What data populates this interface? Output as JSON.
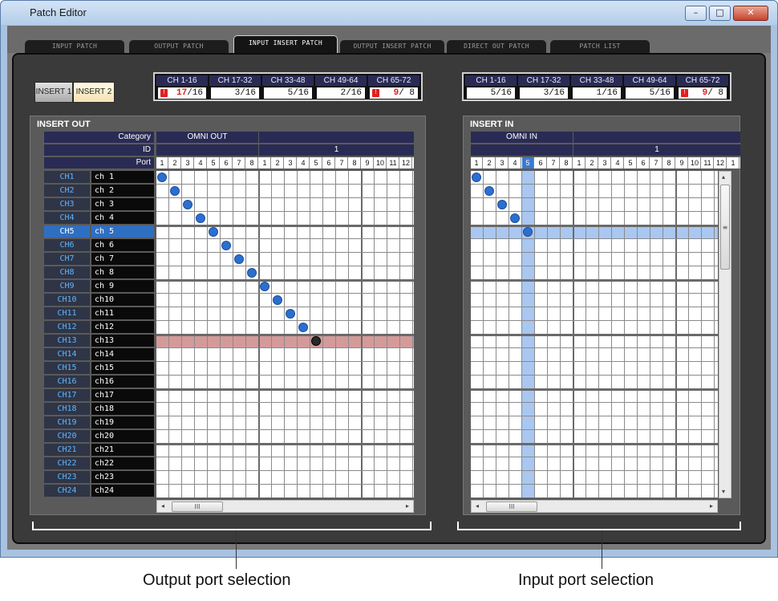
{
  "window": {
    "title": "Patch Editor",
    "minimize_glyph": "–",
    "maximize_glyph": "□",
    "close_glyph": "✕"
  },
  "tabs": [
    {
      "label": "INPUT PATCH",
      "active": false
    },
    {
      "label": "OUTPUT PATCH",
      "active": false
    },
    {
      "label": "INPUT INSERT PATCH",
      "active": true
    },
    {
      "label": "OUTPUT INSERT PATCH",
      "active": false
    },
    {
      "label": "DIRECT OUT PATCH",
      "active": false
    },
    {
      "label": "PATCH LIST",
      "active": false
    }
  ],
  "insert_buttons": {
    "insert1": "INSERT 1",
    "insert2": "INSERT 2",
    "active": "INSERT 2"
  },
  "out_counts": [
    {
      "range": "CH 1-16",
      "count": "17",
      "total": "/16",
      "warning": true
    },
    {
      "range": "CH 17-32",
      "count": "3",
      "total": "/16",
      "warning": false
    },
    {
      "range": "CH 33-48",
      "count": "5",
      "total": "/16",
      "warning": false
    },
    {
      "range": "CH 49-64",
      "count": "2",
      "total": "/16",
      "warning": false
    },
    {
      "range": "CH 65-72",
      "count": "9",
      "total": "/ 8",
      "warning": true
    }
  ],
  "in_counts": [
    {
      "range": "CH 1-16",
      "count": "5",
      "total": "/16",
      "warning": false
    },
    {
      "range": "CH 17-32",
      "count": "3",
      "total": "/16",
      "warning": false
    },
    {
      "range": "CH 33-48",
      "count": "1",
      "total": "/16",
      "warning": false
    },
    {
      "range": "CH 49-64",
      "count": "5",
      "total": "/16",
      "warning": false
    },
    {
      "range": "CH 65-72",
      "count": "9",
      "total": "/ 8",
      "warning": true
    }
  ],
  "insert_out": {
    "title": "INSERT OUT",
    "category_label": "Category",
    "id_label": "ID",
    "port_label": "Port",
    "category": "OMNI OUT",
    "id_value": "1",
    "ports": [
      "1",
      "2",
      "3",
      "4",
      "5",
      "6",
      "7",
      "8",
      "1",
      "2",
      "3",
      "4",
      "5",
      "6",
      "7",
      "8",
      "9",
      "10",
      "11",
      "12"
    ],
    "highlight_row": 12,
    "patches": [
      [
        0,
        0
      ],
      [
        1,
        1
      ],
      [
        2,
        2
      ],
      [
        3,
        3
      ],
      [
        4,
        4
      ],
      [
        5,
        5
      ],
      [
        6,
        6
      ],
      [
        7,
        7
      ],
      [
        8,
        8
      ],
      [
        9,
        9
      ],
      [
        10,
        10
      ],
      [
        11,
        11
      ],
      [
        12,
        12
      ]
    ],
    "conflict_patch": [
      12,
      12
    ]
  },
  "insert_in": {
    "title": "INSERT IN",
    "category": "OMNI IN",
    "id_value": "1",
    "ports": [
      "1",
      "2",
      "3",
      "4",
      "5",
      "6",
      "7",
      "8",
      "1",
      "2",
      "3",
      "4",
      "5",
      "6",
      "7",
      "8",
      "9",
      "10",
      "11",
      "12",
      "1"
    ],
    "highlight_col": 4,
    "highlight_row": 4,
    "patches": [
      [
        0,
        0
      ],
      [
        1,
        1
      ],
      [
        2,
        2
      ],
      [
        3,
        3
      ],
      [
        4,
        4
      ]
    ]
  },
  "channels": [
    {
      "ch": "CH1",
      "name": "ch 1"
    },
    {
      "ch": "CH2",
      "name": "ch 2"
    },
    {
      "ch": "CH3",
      "name": "ch 3"
    },
    {
      "ch": "CH4",
      "name": "ch 4"
    },
    {
      "ch": "CH5",
      "name": "ch 5"
    },
    {
      "ch": "CH6",
      "name": "ch 6"
    },
    {
      "ch": "CH7",
      "name": "ch 7"
    },
    {
      "ch": "CH8",
      "name": "ch 8"
    },
    {
      "ch": "CH9",
      "name": "ch 9"
    },
    {
      "ch": "CH10",
      "name": "ch10"
    },
    {
      "ch": "CH11",
      "name": "ch11"
    },
    {
      "ch": "CH12",
      "name": "ch12"
    },
    {
      "ch": "CH13",
      "name": "ch13"
    },
    {
      "ch": "CH14",
      "name": "ch14"
    },
    {
      "ch": "CH15",
      "name": "ch15"
    },
    {
      "ch": "CH16",
      "name": "ch16"
    },
    {
      "ch": "CH17",
      "name": "ch17"
    },
    {
      "ch": "CH18",
      "name": "ch18"
    },
    {
      "ch": "CH19",
      "name": "ch19"
    },
    {
      "ch": "CH20",
      "name": "ch20"
    },
    {
      "ch": "CH21",
      "name": "ch21"
    },
    {
      "ch": "CH22",
      "name": "ch22"
    },
    {
      "ch": "CH23",
      "name": "ch23"
    },
    {
      "ch": "CH24",
      "name": "ch24"
    }
  ],
  "selected_channel": "CH5",
  "scroll": {
    "left_arrow": "◂",
    "right_arrow": "▸",
    "up_arrow": "▴",
    "down_arrow": "▾",
    "thumb_grip": "III",
    "vthumb_grip": "≡"
  },
  "captions": {
    "output": "Output port selection",
    "input": "Input port selection"
  }
}
